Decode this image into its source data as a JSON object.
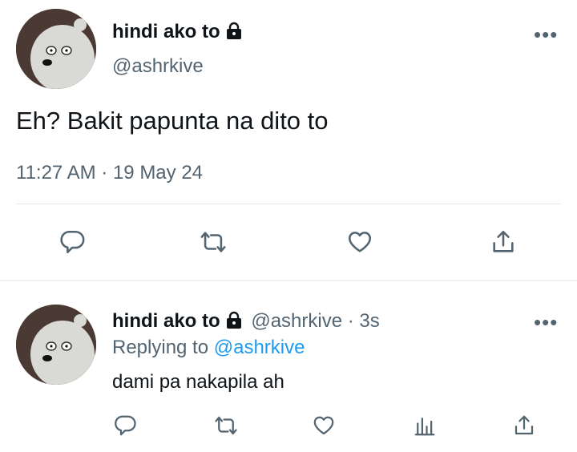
{
  "main_tweet": {
    "display_name": "hindi ako to",
    "handle": "@ashrkive",
    "text": "Eh? Bakit papunta na dito to",
    "timestamp": "11:27 AM · 19 May 24",
    "more_label": "•••"
  },
  "reply_tweet": {
    "display_name": "hindi ako to",
    "handle": "@ashrkive",
    "separator": "·",
    "time": "3s",
    "replying_label": "Replying to",
    "replying_handle": "@ashrkive",
    "text": "dami pa nakapila ah",
    "more_label": "•••"
  },
  "icons": [
    "reply-icon",
    "retweet-icon",
    "like-icon",
    "analytics-icon",
    "share-icon",
    "lock-icon",
    "more-icon"
  ],
  "colors": {
    "text": "#0f1419",
    "muted": "#536471",
    "link": "#1d9bf0",
    "divider": "#e5e7ea",
    "icon": "#536471"
  }
}
